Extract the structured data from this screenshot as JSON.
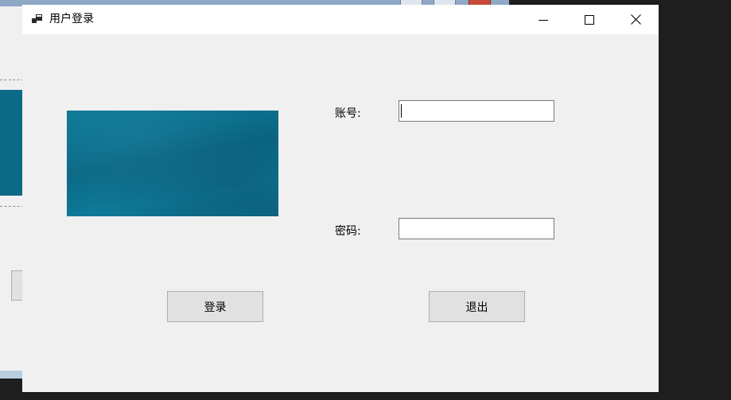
{
  "window": {
    "title": "用户登录",
    "icon": "app-window-icon"
  },
  "caption_buttons": {
    "minimize_icon": "minimize-icon",
    "maximize_icon": "maximize-icon",
    "close_icon": "close-icon"
  },
  "form": {
    "account_label": "账号:",
    "account_value": "",
    "password_label": "密码:",
    "password_value": "",
    "login_button": "登录",
    "exit_button": "退出"
  },
  "colors": {
    "picture_teal": "#0b6a86",
    "form_background": "#f0f0f0",
    "button_face": "#e1e1e1"
  }
}
